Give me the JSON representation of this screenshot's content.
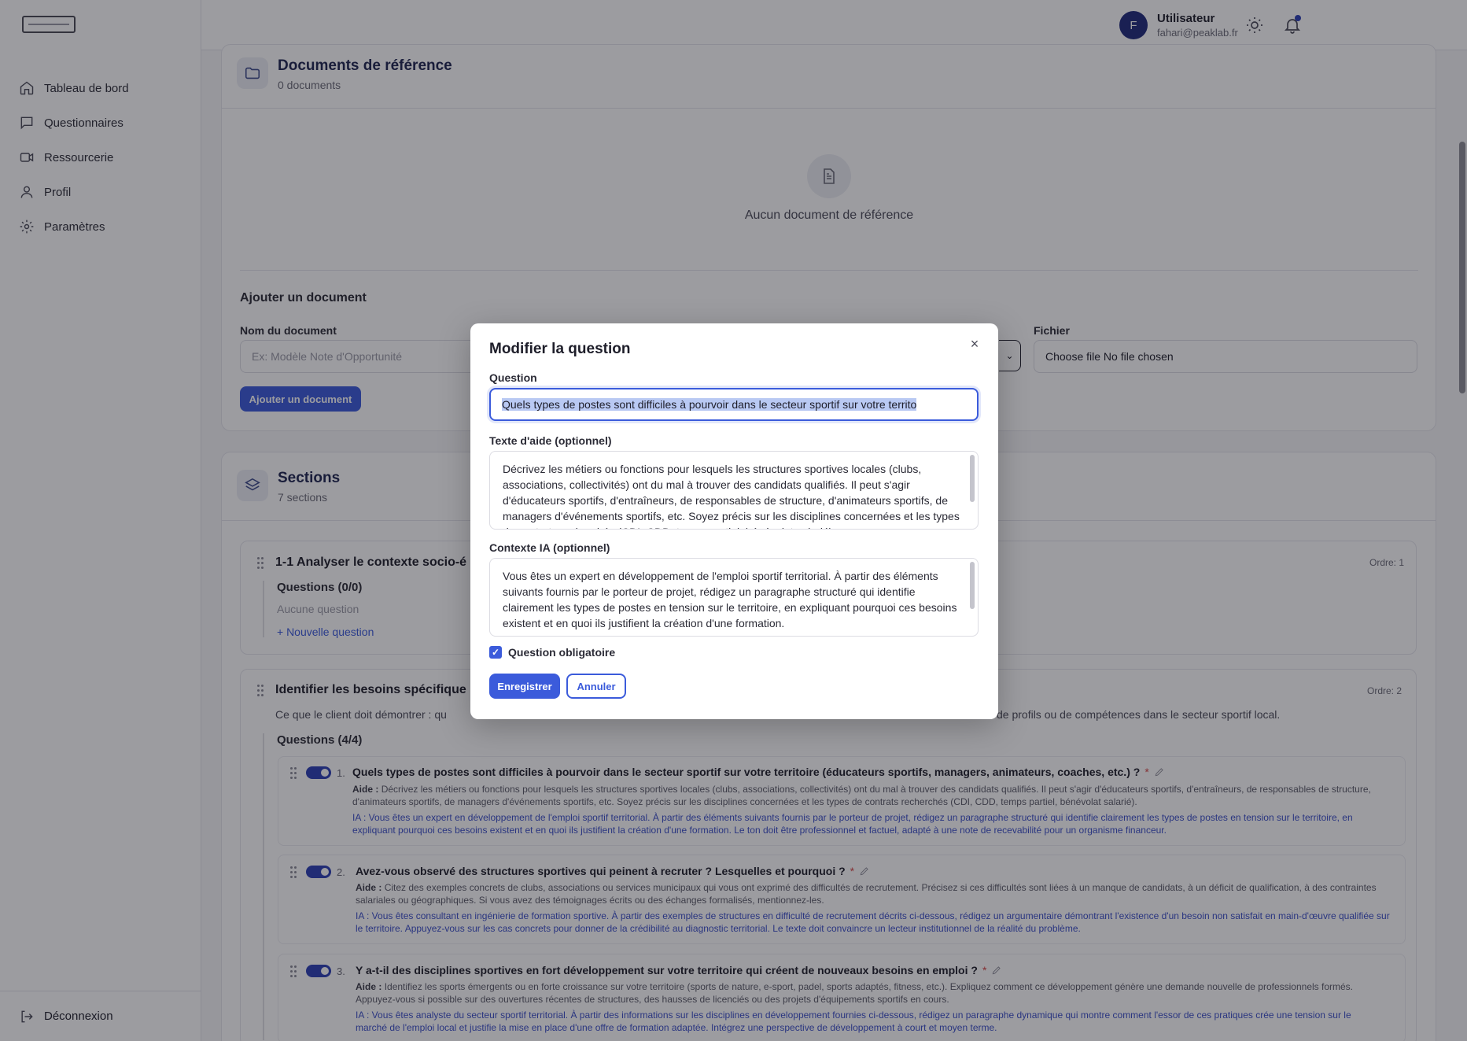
{
  "sidebar": {
    "items": [
      {
        "label": "Tableau de bord",
        "icon": "home-icon"
      },
      {
        "label": "Questionnaires",
        "icon": "message-square-icon"
      },
      {
        "label": "Ressourcerie",
        "icon": "video-icon"
      },
      {
        "label": "Profil",
        "icon": "user-icon"
      },
      {
        "label": "Paramètres",
        "icon": "gear-icon"
      }
    ],
    "logout_label": "Déconnexion"
  },
  "topbar": {
    "avatar_initial": "F",
    "user_name": "Utilisateur",
    "user_email": "fahari@peaklab.fr"
  },
  "documents": {
    "title": "Documents de référence",
    "count": "0 documents",
    "empty_text": "Aucun document de référence",
    "add_title": "Ajouter un document",
    "name_label": "Nom du document",
    "name_placeholder": "Ex: Modèle Note d'Opportunité",
    "file_label": "Fichier",
    "file_value": "Choose file No file chosen",
    "add_button": "Ajouter un document"
  },
  "sections": {
    "title": "Sections",
    "count": "7 sections",
    "blocks": [
      {
        "title": "1-1 Analyser le contexte socio-é",
        "order": "Ordre: 1",
        "questions_label": "Questions (0/0)",
        "empty": "Aucune question",
        "new_question": "+ Nouvelle question"
      },
      {
        "title": "Identifier les besoins spécifique",
        "order": "Ordre: 2",
        "desc_start": "Ce que le client doit démontrer : qu",
        "desc_end": "de profils ou de compétences dans le secteur sportif local.",
        "questions_label": "Questions (4/4)"
      }
    ]
  },
  "questions": [
    {
      "num": "1.",
      "text": "Quels types de postes sont difficiles à pourvoir dans le secteur sportif sur votre territoire (éducateurs sportifs, managers, animateurs, coaches, etc.) ?",
      "required": "*",
      "help_label": "Aide :",
      "help": "Décrivez les métiers ou fonctions pour lesquels les structures sportives locales (clubs, associations, collectivités) ont du mal à trouver des candidats qualifiés. Il peut s'agir d'éducateurs sportifs, d'entraîneurs, de responsables de structure, d'animateurs sportifs, de managers d'événements sportifs, etc. Soyez précis sur les disciplines concernées et les types de contrats recherchés (CDI, CDD, temps partiel, bénévolat salarié).",
      "ai": "IA : Vous êtes un expert en développement de l'emploi sportif territorial. À partir des éléments suivants fournis par le porteur de projet, rédigez un paragraphe structuré qui identifie clairement les types de postes en tension sur le territoire, en expliquant pourquoi ces besoins existent et en quoi ils justifient la création d'une formation. Le ton doit être professionnel et factuel, adapté à une note de recevabilité pour un organisme financeur."
    },
    {
      "num": "2.",
      "text": "Avez-vous observé des structures sportives qui peinent à recruter ? Lesquelles et pourquoi ?",
      "required": "*",
      "help_label": "Aide :",
      "help": "Citez des exemples concrets de clubs, associations ou services municipaux qui vous ont exprimé des difficultés de recrutement. Précisez si ces difficultés sont liées à un manque de candidats, à un déficit de qualification, à des contraintes salariales ou géographiques. Si vous avez des témoignages écrits ou des échanges formalisés, mentionnez-les.",
      "ai": "IA : Vous êtes consultant en ingénierie de formation sportive. À partir des exemples de structures en difficulté de recrutement décrits ci-dessous, rédigez un argumentaire démontrant l'existence d'un besoin non satisfait en main-d'œuvre qualifiée sur le territoire. Appuyez-vous sur les cas concrets pour donner de la crédibilité au diagnostic territorial. Le texte doit convaincre un lecteur institutionnel de la réalité du problème."
    },
    {
      "num": "3.",
      "text": "Y a-t-il des disciplines sportives en fort développement sur votre territoire qui créent de nouveaux besoins en emploi ?",
      "required": "*",
      "help_label": "Aide :",
      "help": "Identifiez les sports émergents ou en forte croissance sur votre territoire (sports de nature, e-sport, padel, sports adaptés, fitness, etc.). Expliquez comment ce développement génère une demande nouvelle de professionnels formés. Appuyez-vous si possible sur des ouvertures récentes de structures, des hausses de licenciés ou des projets d'équipements sportifs en cours.",
      "ai": "IA : Vous êtes analyste du secteur sportif territorial. À partir des informations sur les disciplines en développement fournies ci-dessous, rédigez un paragraphe dynamique qui montre comment l'essor de ces pratiques crée une tension sur le marché de l'emploi local et justifie la mise en place d'une offre de formation adaptée. Intégrez une perspective de développement à court et moyen terme."
    }
  ],
  "modal": {
    "title": "Modifier la question",
    "close": "×",
    "question_label": "Question",
    "question_value": "Quels types de postes sont difficiles à pourvoir dans le secteur sportif sur votre territo",
    "help_label": "Texte d'aide (optionnel)",
    "help_value": "Décrivez les métiers ou fonctions pour lesquels les structures sportives locales (clubs, associations, collectivités) ont du mal à trouver des candidats qualifiés. Il peut s'agir d'éducateurs sportifs, d'entraîneurs, de responsables de structure, d'animateurs sportifs, de managers d'événements sportifs, etc. Soyez précis sur les disciplines concernées et les types de contrats recherchés (CDI, CDD, temps partiel, bénévolat salarié).",
    "ai_label": "Contexte IA (optionnel)",
    "ai_value": "Vous êtes un expert en développement de l'emploi sportif territorial. À partir des éléments suivants fournis par le porteur de projet, rédigez un paragraphe structuré qui identifie clairement les types de postes en tension sur le territoire, en expliquant pourquoi ces besoins existent et en quoi ils justifient la création d'une formation.",
    "required_label": "Question obligatoire",
    "save": "Enregistrer",
    "cancel": "Annuler"
  }
}
